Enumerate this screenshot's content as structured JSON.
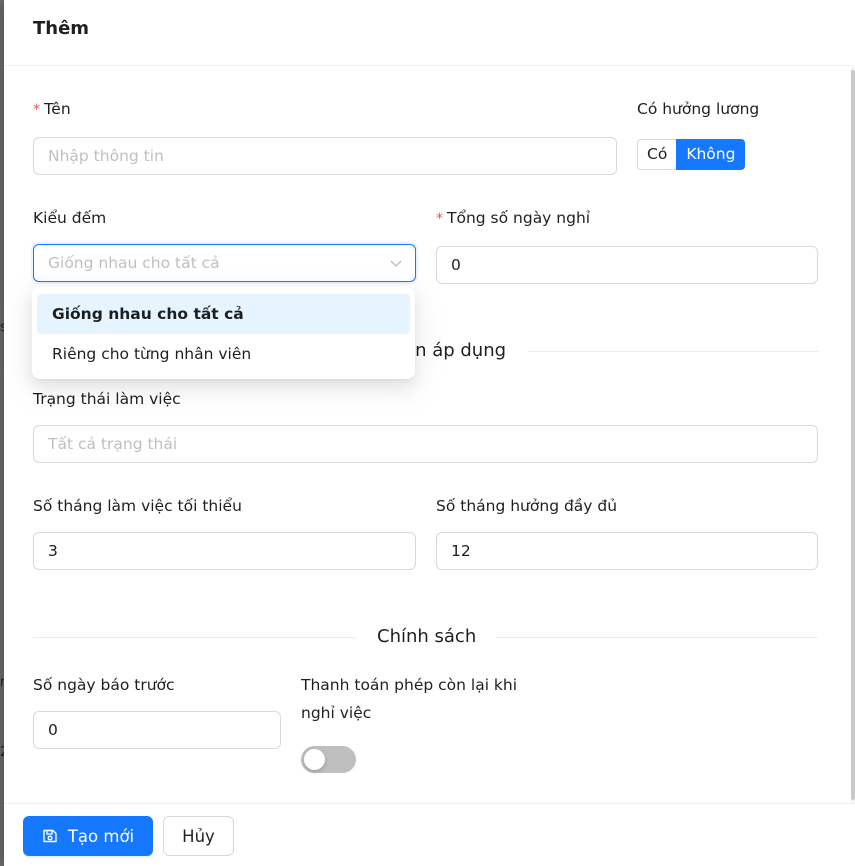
{
  "drawer": {
    "title": "Thêm"
  },
  "form": {
    "name": {
      "label": "Tên",
      "placeholder": "Nhập thông tin",
      "required": true
    },
    "paid": {
      "label": "Có hưởng lương",
      "options": [
        "Có",
        "Không"
      ],
      "selected": "Không"
    },
    "count_type": {
      "label": "Kiểu đếm",
      "value": "Giống nhau cho tất cả",
      "options": [
        "Giống nhau cho tất cả",
        "Riêng cho từng nhân viên"
      ],
      "selected": "Giống nhau cho tất cả"
    },
    "total_days_off": {
      "label": "Tổng số ngày nghỉ",
      "value": "0",
      "required": true
    },
    "conditions_section": {
      "label_partial": "en áp dụng"
    },
    "work_status": {
      "label": "Trạng thái làm việc",
      "placeholder": "Tất cả trạng thái"
    },
    "min_months": {
      "label": "Số tháng làm việc tối thiểu",
      "value": "3"
    },
    "full_months": {
      "label": "Số tháng hưởng đầy đủ",
      "value": "12"
    },
    "policy_section": {
      "label": "Chính sách"
    },
    "notice_days": {
      "label": "Số ngày báo trước",
      "value": "0"
    },
    "payout_on_leave": {
      "label_line1": "Thanh toán phép còn lại khi",
      "label_line2": "nghỉ việc",
      "enabled": false
    }
  },
  "footer": {
    "create_label": "Tạo mới",
    "cancel_label": "Hủy"
  },
  "colors": {
    "primary": "#1677ff",
    "required": "#ff4d4f",
    "option_selected_bg": "#e6f4ff",
    "switch_off": "#bfbfbf"
  },
  "icons": {
    "select_arrow": "chevron-down-icon",
    "create_button": "save-icon"
  }
}
